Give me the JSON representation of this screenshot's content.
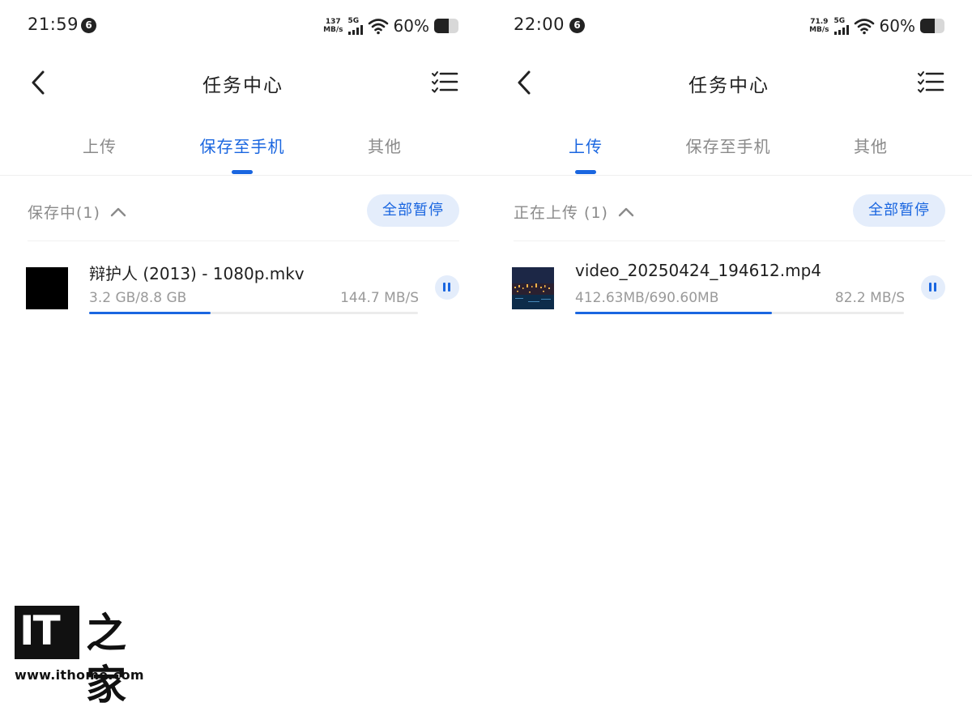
{
  "colors": {
    "accent": "#1a66e0",
    "accent_bg": "#e4edfb",
    "muted_text": "#9a9a9a",
    "primary_text": "#1f1f1f"
  },
  "left": {
    "status": {
      "time": "21:59",
      "notif_badge": "6",
      "net_speed_value": "137",
      "net_speed_unit": "MB/s",
      "network": "5G",
      "battery": "60%",
      "battery_level": 0.6
    },
    "nav": {
      "title": "任务中心",
      "back_icon": "chevron-left-icon",
      "menu_icon": "task-list-icon"
    },
    "tabs": [
      {
        "label": "上传"
      },
      {
        "label": "保存至手机"
      },
      {
        "label": "其他"
      }
    ],
    "active_tab_index": 1,
    "section": {
      "title": "保存中(1)",
      "pause_all": "全部暂停"
    },
    "task": {
      "name": "辩护人 (2013) - 1080p.mkv",
      "size": "3.2 GB/8.8 GB",
      "speed": "144.7 MB/S",
      "progress": 0.37,
      "thumb": "black"
    }
  },
  "right": {
    "status": {
      "time": "22:00",
      "notif_badge": "6",
      "net_speed_value": "71.9",
      "net_speed_unit": "MB/s",
      "network": "5G",
      "battery": "60%",
      "battery_level": 0.6
    },
    "nav": {
      "title": "任务中心",
      "back_icon": "chevron-left-icon",
      "menu_icon": "task-list-icon"
    },
    "tabs": [
      {
        "label": "上传"
      },
      {
        "label": "保存至手机"
      },
      {
        "label": "其他"
      }
    ],
    "active_tab_index": 0,
    "section": {
      "title": "正在上传 (1)",
      "pause_all": "全部暂停"
    },
    "task": {
      "name": "video_20250424_194612.mp4",
      "size": "412.63MB/690.60MB",
      "speed": "82.2 MB/S",
      "progress": 0.5975,
      "thumb": "night-city"
    }
  },
  "watermark": {
    "logo_text": "IT",
    "cn_text": "之家",
    "url": "www.ithome.com"
  }
}
